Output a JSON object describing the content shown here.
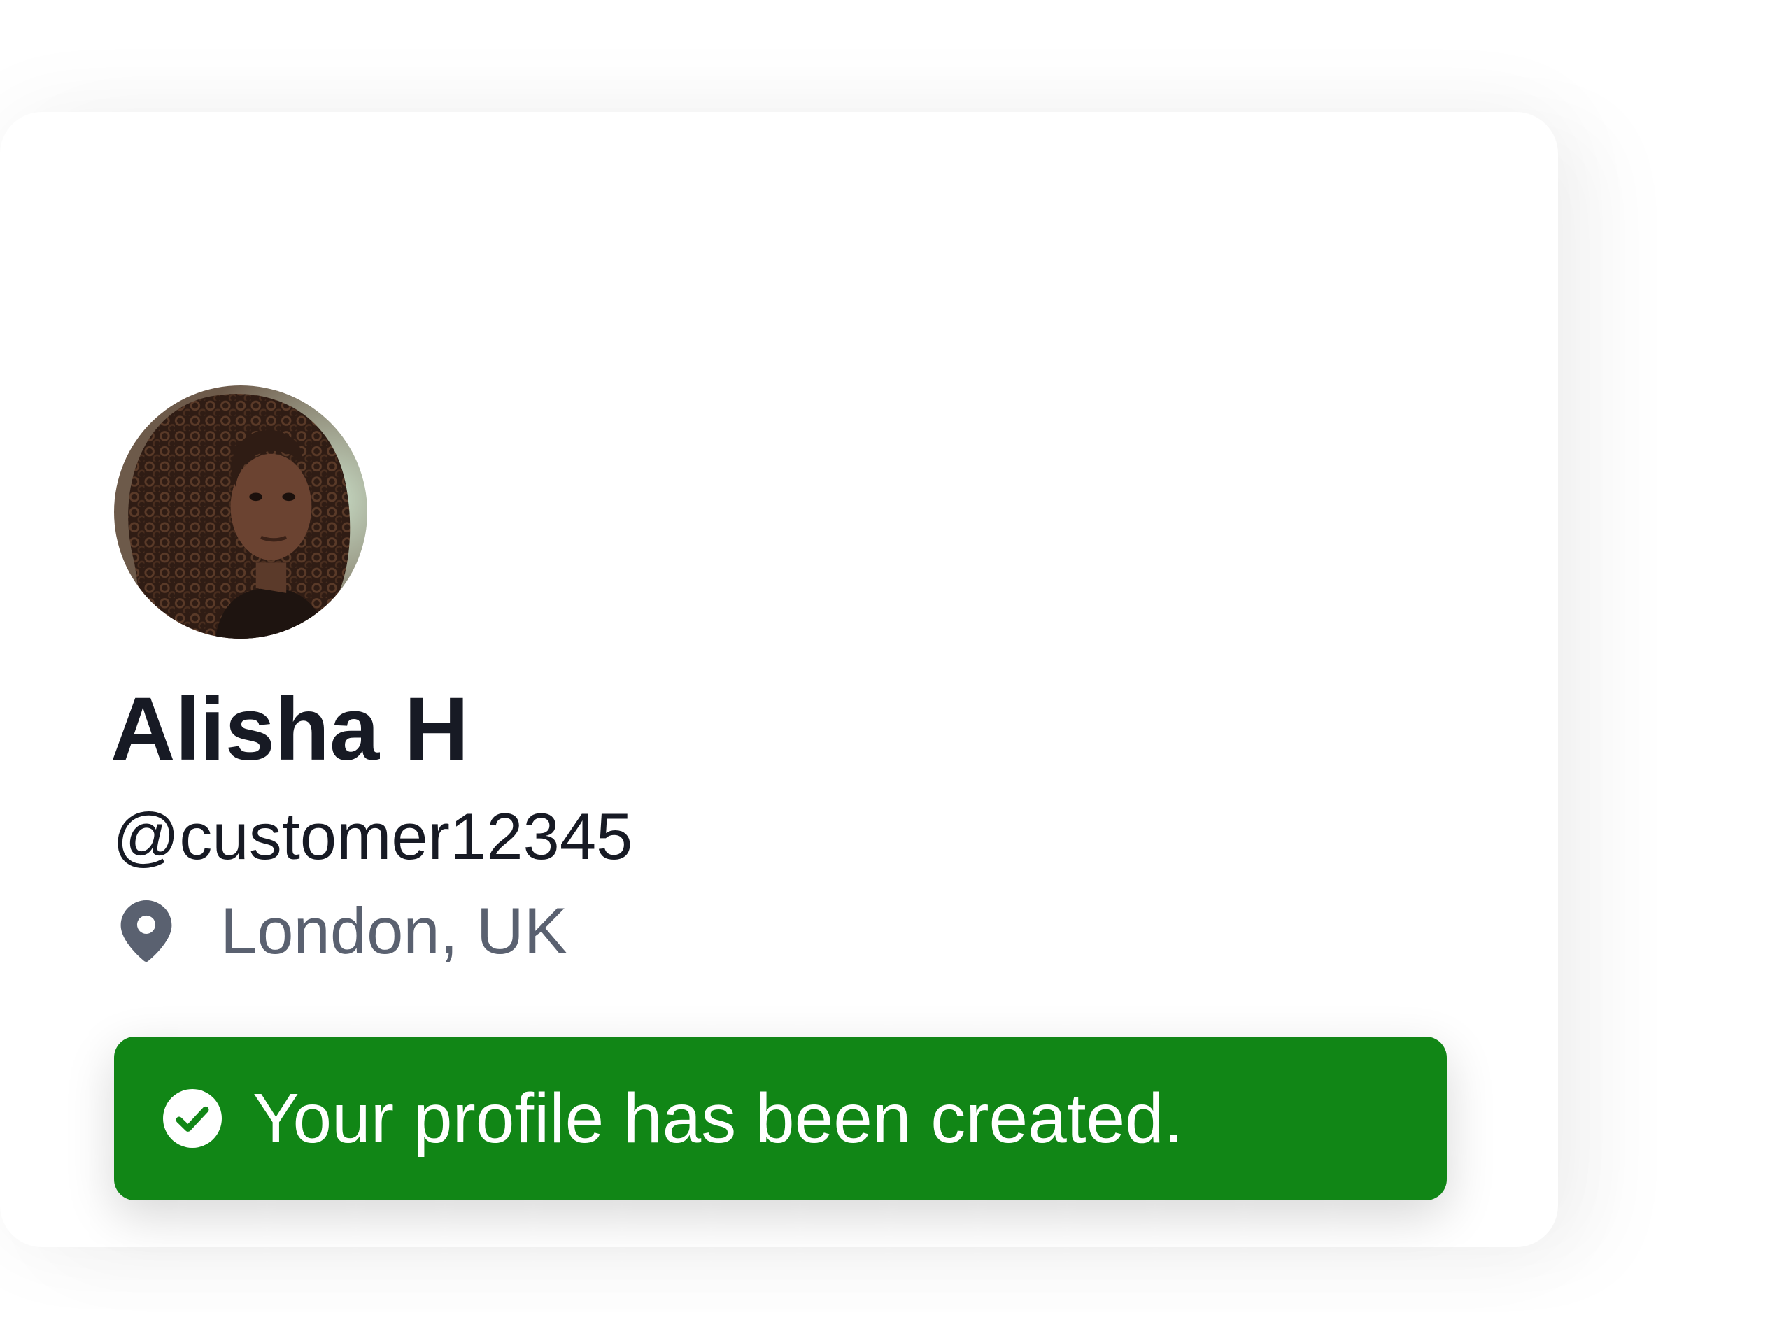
{
  "profile": {
    "avatar_alt": "Alisha H",
    "name": "Alisha H",
    "handle": "@customer12345",
    "location": "London, UK",
    "location_icon": "map-pin-icon"
  },
  "toast": {
    "icon": "check-circle-icon",
    "message": "Your profile has been created.",
    "background_color": "#118616"
  }
}
